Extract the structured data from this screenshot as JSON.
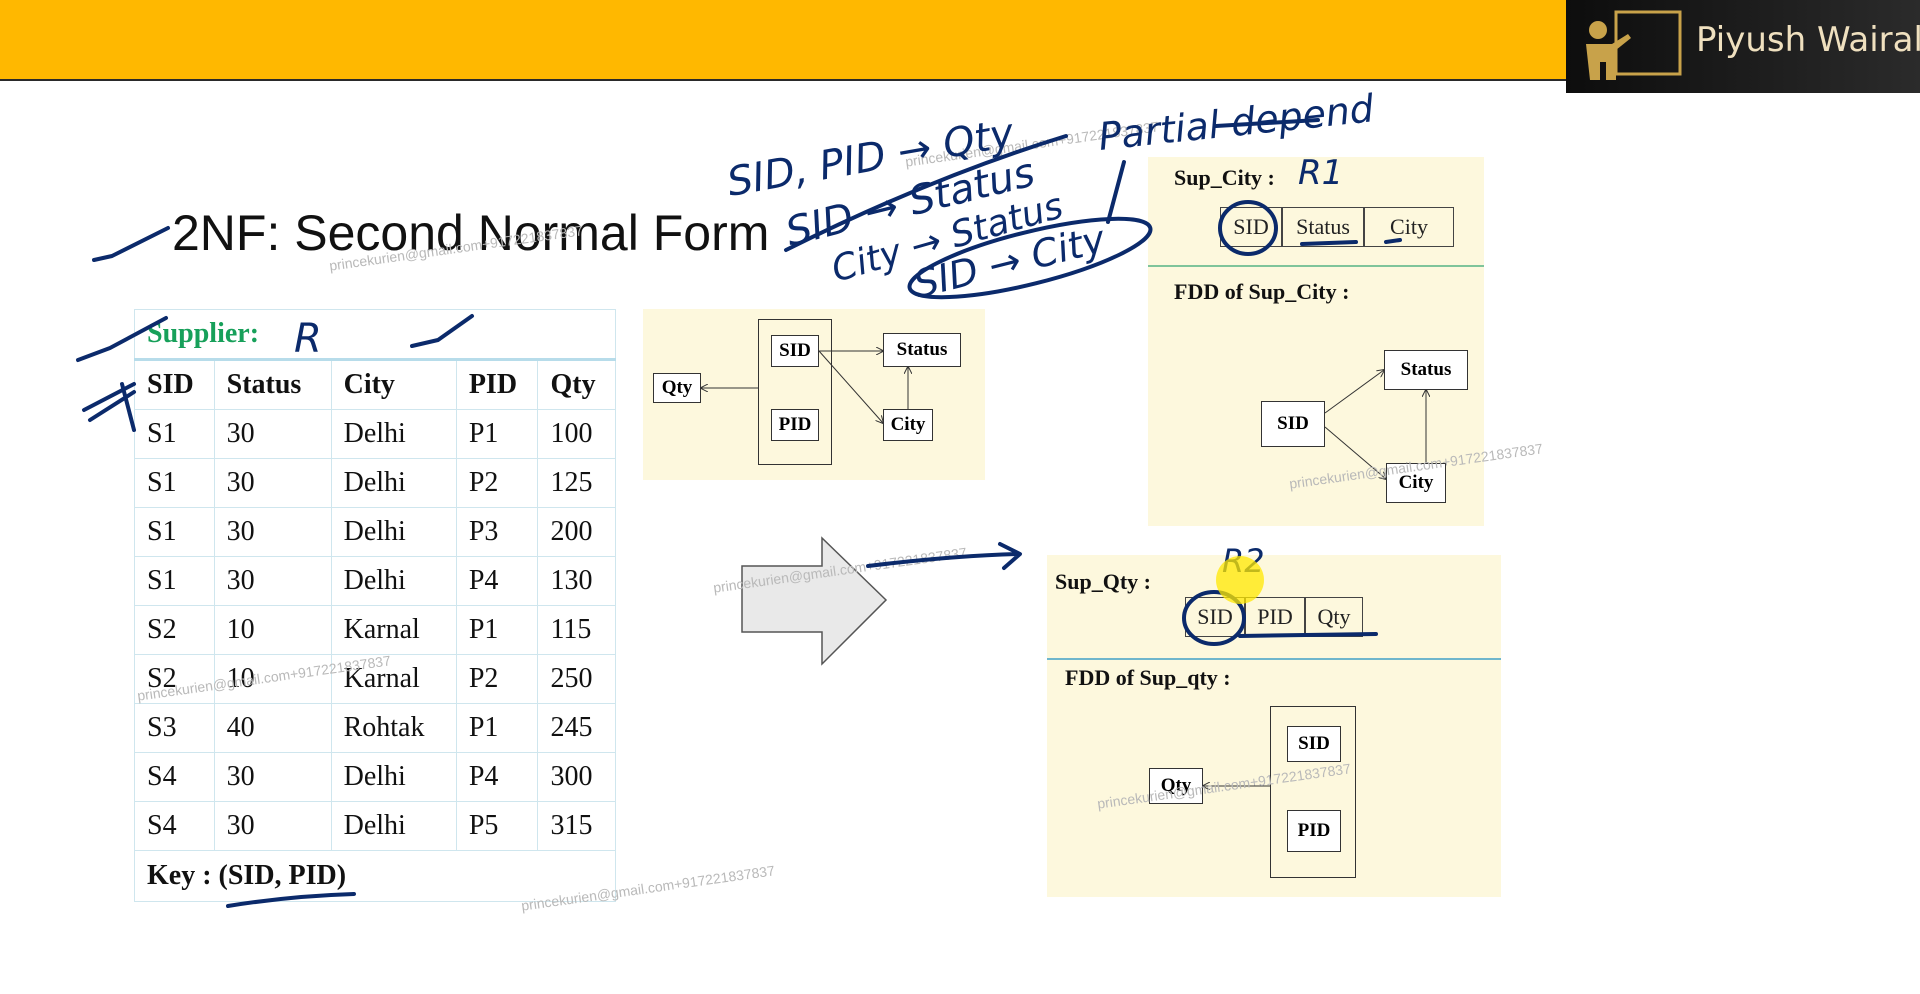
{
  "header": {
    "brand_name": "Piyush Wairale"
  },
  "slide": {
    "title": "2NF: Second Normal Form",
    "supplier_table": {
      "caption": "Supplier:",
      "columns": [
        "SID",
        "Status",
        "City",
        "PID",
        "Qty"
      ],
      "rows": [
        [
          "S1",
          "30",
          "Delhi",
          "P1",
          "100"
        ],
        [
          "S1",
          "30",
          "Delhi",
          "P2",
          "125"
        ],
        [
          "S1",
          "30",
          "Delhi",
          "P3",
          "200"
        ],
        [
          "S1",
          "30",
          "Delhi",
          "P4",
          "130"
        ],
        [
          "S2",
          "10",
          "Karnal",
          "P1",
          "115"
        ],
        [
          "S2",
          "10",
          "Karnal",
          "P2",
          "250"
        ],
        [
          "S3",
          "40",
          "Rohtak",
          "P1",
          "245"
        ],
        [
          "S4",
          "30",
          "Delhi",
          "P4",
          "300"
        ],
        [
          "S4",
          "30",
          "Delhi",
          "P5",
          "315"
        ]
      ],
      "key_label": "Key : (SID, PID)"
    },
    "fdd_main": {
      "nodes": [
        "Qty",
        "SID",
        "PID",
        "Status",
        "City"
      ]
    },
    "sup_city": {
      "title": "Sup_City :",
      "columns": [
        "SID",
        "Status",
        "City"
      ],
      "fdd_title": "FDD of Sup_City :",
      "nodes": [
        "SID",
        "Status",
        "City"
      ]
    },
    "sup_qty": {
      "title": "Sup_Qty :",
      "columns": [
        "SID",
        "PID",
        "Qty"
      ],
      "fdd_title": "FDD of Sup_qty :",
      "nodes": [
        "Qty",
        "SID",
        "PID"
      ]
    }
  },
  "annotations": {
    "fd1": "SID, PID → Qty",
    "fd2": "SID → Status",
    "fd3": "City → Status",
    "fd4": "SID → City",
    "partial": "Partial depend",
    "r1": "R1",
    "r2": "R2",
    "r": "R"
  },
  "watermark": "princekurien@gmail.com+917221837837",
  "colors": {
    "accent_bar": "#ffb800",
    "ink": "#0b2a6b",
    "table_caption": "#17a05a",
    "panel": "#fdf8dd"
  }
}
